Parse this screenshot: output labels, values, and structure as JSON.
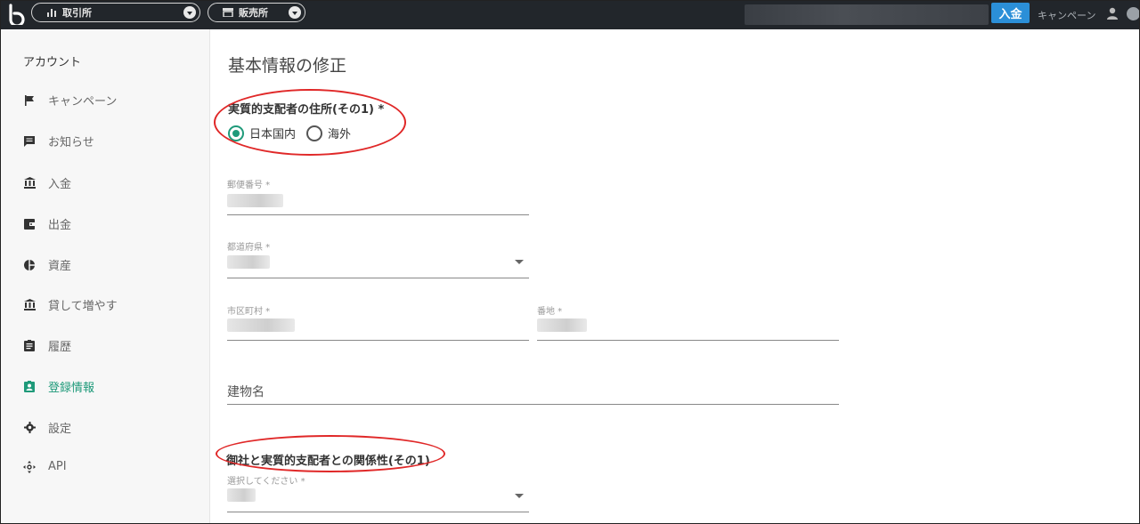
{
  "topbar": {
    "exchange_label": "取引所",
    "sales_label": "販売所",
    "deposit_label": "入金",
    "campaign_label": "キャンペーン"
  },
  "sidebar": {
    "title": "アカウント",
    "items": [
      {
        "label": "キャンペーン",
        "icon": "flag-icon"
      },
      {
        "label": "お知らせ",
        "icon": "message-icon"
      },
      {
        "label": "入金",
        "icon": "bank-icon"
      },
      {
        "label": "出金",
        "icon": "wallet-icon"
      },
      {
        "label": "資産",
        "icon": "pie-chart-icon"
      },
      {
        "label": "貸して増やす",
        "icon": "bank-icon"
      },
      {
        "label": "履歴",
        "icon": "assignment-icon"
      },
      {
        "label": "登録情報",
        "icon": "id-card-icon",
        "active": true
      },
      {
        "label": "設定",
        "icon": "gear-icon"
      },
      {
        "label": "API",
        "icon": "api-icon"
      }
    ]
  },
  "main": {
    "title": "基本情報の修正",
    "address_section_label": "実質的支配者の住所(その1) *",
    "radio_domestic": "日本国内",
    "radio_overseas": "海外",
    "postal_label": "郵便番号 *",
    "prefecture_label": "都道府県 *",
    "city_label": "市区町村 *",
    "street_label": "番地 *",
    "building_placeholder": "建物名",
    "relation_section_label": "御社と実質的支配者との関係性(その1)",
    "relation_select_label": "選択してください *"
  },
  "colors": {
    "accent": "#1f9a7a",
    "topbar": "#22262b",
    "deposit": "#2b8fd8",
    "highlight": "#e02828"
  }
}
